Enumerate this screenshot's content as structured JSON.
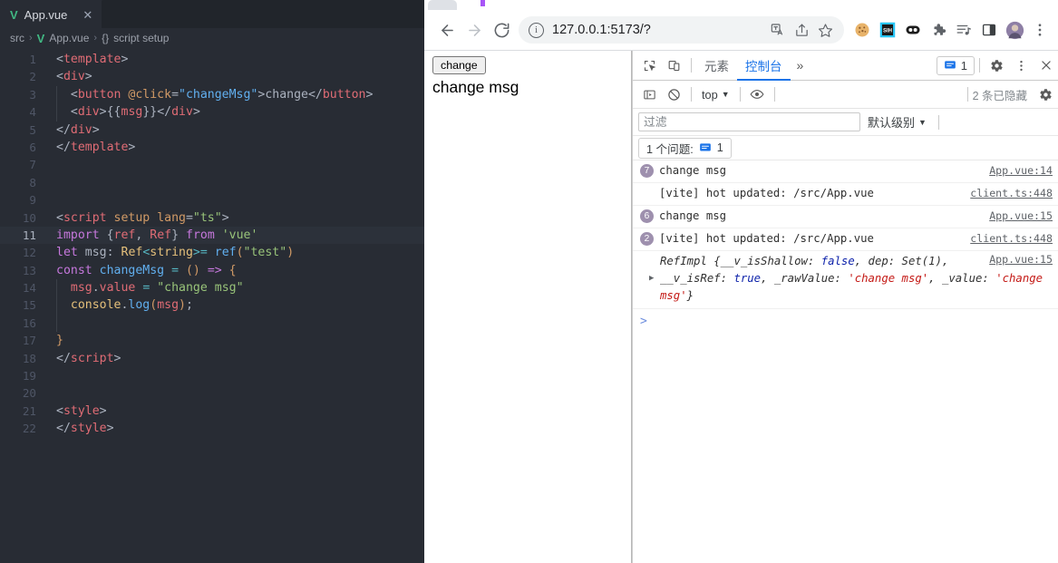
{
  "editor": {
    "tab": {
      "label": "App.vue",
      "icon": "vue-logo-icon",
      "close": "✕"
    },
    "breadcrumb": {
      "folder": "src",
      "file": "App.vue",
      "symbol": "script setup",
      "brace": "{}"
    },
    "active_line": 11,
    "lines": [
      {
        "n": "1",
        "tokens": [
          {
            "t": "<",
            "c": "t-br"
          },
          {
            "t": "template",
            "c": "t-tag"
          },
          {
            "t": ">",
            "c": "t-br"
          }
        ]
      },
      {
        "n": "2",
        "tokens": [
          {
            "t": "<",
            "c": "t-br"
          },
          {
            "t": "div",
            "c": "t-tag"
          },
          {
            "t": ">",
            "c": "t-br"
          }
        ]
      },
      {
        "n": "3",
        "indent": 1,
        "tokens": [
          {
            "t": "  <",
            "c": "t-br"
          },
          {
            "t": "button",
            "c": "t-tag"
          },
          {
            "t": " ",
            "c": "t-txt"
          },
          {
            "t": "@click",
            "c": "t-attr"
          },
          {
            "t": "=",
            "c": "t-br"
          },
          {
            "t": "\"changeMsg\"",
            "c": "t-fn"
          },
          {
            "t": ">",
            "c": "t-br"
          },
          {
            "t": "change",
            "c": "t-txt"
          },
          {
            "t": "</",
            "c": "t-br"
          },
          {
            "t": "button",
            "c": "t-tag"
          },
          {
            "t": ">",
            "c": "t-br"
          }
        ]
      },
      {
        "n": "4",
        "indent": 1,
        "tokens": [
          {
            "t": "  <",
            "c": "t-br"
          },
          {
            "t": "div",
            "c": "t-tag"
          },
          {
            "t": ">",
            "c": "t-br"
          },
          {
            "t": "{{",
            "c": "t-punc"
          },
          {
            "t": "msg",
            "c": "t-var"
          },
          {
            "t": "}}",
            "c": "t-punc"
          },
          {
            "t": "</",
            "c": "t-br"
          },
          {
            "t": "div",
            "c": "t-tag"
          },
          {
            "t": ">",
            "c": "t-br"
          }
        ]
      },
      {
        "n": "5",
        "tokens": [
          {
            "t": "</",
            "c": "t-br"
          },
          {
            "t": "div",
            "c": "t-tag"
          },
          {
            "t": ">",
            "c": "t-br"
          }
        ]
      },
      {
        "n": "6",
        "tokens": [
          {
            "t": "</",
            "c": "t-br"
          },
          {
            "t": "template",
            "c": "t-tag"
          },
          {
            "t": ">",
            "c": "t-br"
          }
        ]
      },
      {
        "n": "7",
        "tokens": []
      },
      {
        "n": "8",
        "tokens": []
      },
      {
        "n": "9",
        "tokens": []
      },
      {
        "n": "10",
        "tokens": [
          {
            "t": "<",
            "c": "t-br"
          },
          {
            "t": "script",
            "c": "t-tag"
          },
          {
            "t": " ",
            "c": "t-txt"
          },
          {
            "t": "setup",
            "c": "t-attr"
          },
          {
            "t": " ",
            "c": "t-txt"
          },
          {
            "t": "lang",
            "c": "t-attr"
          },
          {
            "t": "=",
            "c": "t-br"
          },
          {
            "t": "\"ts\"",
            "c": "t-str"
          },
          {
            "t": ">",
            "c": "t-br"
          }
        ]
      },
      {
        "n": "11",
        "tokens": [
          {
            "t": "import",
            "c": "t-kw"
          },
          {
            "t": " ",
            "c": "t-txt"
          },
          {
            "t": "{",
            "c": "t-punc"
          },
          {
            "t": "ref",
            "c": "t-var"
          },
          {
            "t": ", ",
            "c": "t-punc"
          },
          {
            "t": "Ref",
            "c": "t-var"
          },
          {
            "t": "}",
            "c": "t-punc"
          },
          {
            "t": " ",
            "c": "t-txt"
          },
          {
            "t": "from",
            "c": "t-kw"
          },
          {
            "t": " ",
            "c": "t-txt"
          },
          {
            "t": "'vue'",
            "c": "t-str"
          }
        ]
      },
      {
        "n": "12",
        "tokens": [
          {
            "t": "let",
            "c": "t-kw"
          },
          {
            "t": " ",
            "c": "t-txt"
          },
          {
            "t": "msg",
            "c": "t-txt"
          },
          {
            "t": ": ",
            "c": "t-punc"
          },
          {
            "t": "Ref",
            "c": "t-type"
          },
          {
            "t": "<",
            "c": "t-op"
          },
          {
            "t": "string",
            "c": "t-type"
          },
          {
            "t": ">",
            "c": "t-op"
          },
          {
            "t": "= ",
            "c": "t-op"
          },
          {
            "t": "ref",
            "c": "t-fn"
          },
          {
            "t": "(",
            "c": "t-paren"
          },
          {
            "t": "\"test\"",
            "c": "t-str"
          },
          {
            "t": ")",
            "c": "t-paren"
          }
        ]
      },
      {
        "n": "13",
        "tokens": [
          {
            "t": "const",
            "c": "t-kw"
          },
          {
            "t": " ",
            "c": "t-txt"
          },
          {
            "t": "changeMsg",
            "c": "t-fn"
          },
          {
            "t": " ",
            "c": "t-txt"
          },
          {
            "t": "=",
            "c": "t-op"
          },
          {
            "t": " ",
            "c": "t-txt"
          },
          {
            "t": "()",
            "c": "t-paren"
          },
          {
            "t": " ",
            "c": "t-txt"
          },
          {
            "t": "=>",
            "c": "t-kw"
          },
          {
            "t": " ",
            "c": "t-txt"
          },
          {
            "t": "{",
            "c": "t-paren"
          }
        ]
      },
      {
        "n": "14",
        "indent": 1,
        "tokens": [
          {
            "t": "  ",
            "c": "t-txt"
          },
          {
            "t": "msg",
            "c": "t-var"
          },
          {
            "t": ".",
            "c": "t-punc"
          },
          {
            "t": "value",
            "c": "t-var"
          },
          {
            "t": " ",
            "c": "t-txt"
          },
          {
            "t": "=",
            "c": "t-op"
          },
          {
            "t": " ",
            "c": "t-txt"
          },
          {
            "t": "\"change msg\"",
            "c": "t-str"
          }
        ]
      },
      {
        "n": "15",
        "indent": 1,
        "tokens": [
          {
            "t": "  ",
            "c": "t-txt"
          },
          {
            "t": "console",
            "c": "t-obj"
          },
          {
            "t": ".",
            "c": "t-punc"
          },
          {
            "t": "log",
            "c": "t-fn"
          },
          {
            "t": "(",
            "c": "t-paren"
          },
          {
            "t": "msg",
            "c": "t-var"
          },
          {
            "t": ")",
            "c": "t-paren"
          },
          {
            "t": ";",
            "c": "t-punc"
          }
        ]
      },
      {
        "n": "16",
        "indent": 1,
        "tokens": []
      },
      {
        "n": "17",
        "tokens": [
          {
            "t": "}",
            "c": "t-paren"
          }
        ]
      },
      {
        "n": "18",
        "tokens": [
          {
            "t": "</",
            "c": "t-br"
          },
          {
            "t": "script",
            "c": "t-tag"
          },
          {
            "t": ">",
            "c": "t-br"
          }
        ]
      },
      {
        "n": "19",
        "tokens": []
      },
      {
        "n": "20",
        "tokens": []
      },
      {
        "n": "21",
        "tokens": [
          {
            "t": "<",
            "c": "t-br"
          },
          {
            "t": "style",
            "c": "t-tag"
          },
          {
            "t": ">",
            "c": "t-br"
          }
        ]
      },
      {
        "n": "22",
        "tokens": [
          {
            "t": "</",
            "c": "t-br"
          },
          {
            "t": "style",
            "c": "t-tag"
          },
          {
            "t": ">",
            "c": "t-br"
          }
        ]
      }
    ]
  },
  "browser": {
    "back_icon": "back-arrow-icon",
    "forward_icon": "forward-arrow-icon",
    "reload_icon": "reload-icon",
    "url": "127.0.0.1:5173/?",
    "omnibox_icons": [
      "translate-icon",
      "share-icon",
      "bookmark-star-icon"
    ],
    "extension_icons": [
      "cookie-icon",
      "sih-extension-icon",
      "eyes-extension-icon",
      "puzzle-icon",
      "reading-list-icon",
      "side-panel-icon",
      "avatar-icon",
      "browser-menu-icon"
    ]
  },
  "page": {
    "button_label": "change",
    "message": "change msg"
  },
  "devtools": {
    "inspect_icon": "inspect-element-icon",
    "device_icon": "device-toolbar-icon",
    "tabs": [
      {
        "label": "元素",
        "active": false
      },
      {
        "label": "控制台",
        "active": true
      }
    ],
    "more_tabs": "»",
    "issue_chip_count": "1",
    "settings_icon": "settings-gear-icon",
    "kebab_icon": "devtools-menu-icon",
    "close_icon": "close-devtools-icon",
    "sidebar_icon": "console-sidebar-icon",
    "clear_icon": "clear-console-icon",
    "context": "top",
    "eye_icon": "live-expression-icon",
    "hidden_text": "2 条已隐藏",
    "settings2_icon": "console-settings-icon",
    "filter_placeholder": "过滤",
    "filter_value": "",
    "level_label": "默认级别",
    "issues_label": "1 个问题:",
    "issues_count": "1",
    "prompt": ">",
    "messages": [
      {
        "badge": "7",
        "text": "change msg",
        "source": "App.vue:14"
      },
      {
        "badge": "",
        "text": "[vite] hot updated: /src/App.vue",
        "source": "client.ts:448"
      },
      {
        "badge": "6",
        "text": "change msg",
        "source": "App.vue:15"
      },
      {
        "badge": "2",
        "text": "[vite] hot updated: /src/App.vue",
        "source": "client.ts:448"
      }
    ],
    "object_log": {
      "source": "App.vue:15",
      "prefix": "RefImpl {",
      "parts": [
        {
          "t": "__v_isShallow: ",
          "c": "j-name"
        },
        {
          "t": "false",
          "c": "j-bool"
        },
        {
          "t": ", dep: Set(1), __v_isRef: ",
          "c": "j-name"
        },
        {
          "t": "true",
          "c": "j-bool"
        },
        {
          "t": ", _rawValue: ",
          "c": "j-name"
        },
        {
          "t": "'change msg'",
          "c": "j-str"
        },
        {
          "t": ", _value: ",
          "c": "j-name"
        },
        {
          "t": "'change msg'",
          "c": "j-str"
        },
        {
          "t": "}",
          "c": "j-name"
        }
      ],
      "expand_arrow": "▶"
    }
  }
}
